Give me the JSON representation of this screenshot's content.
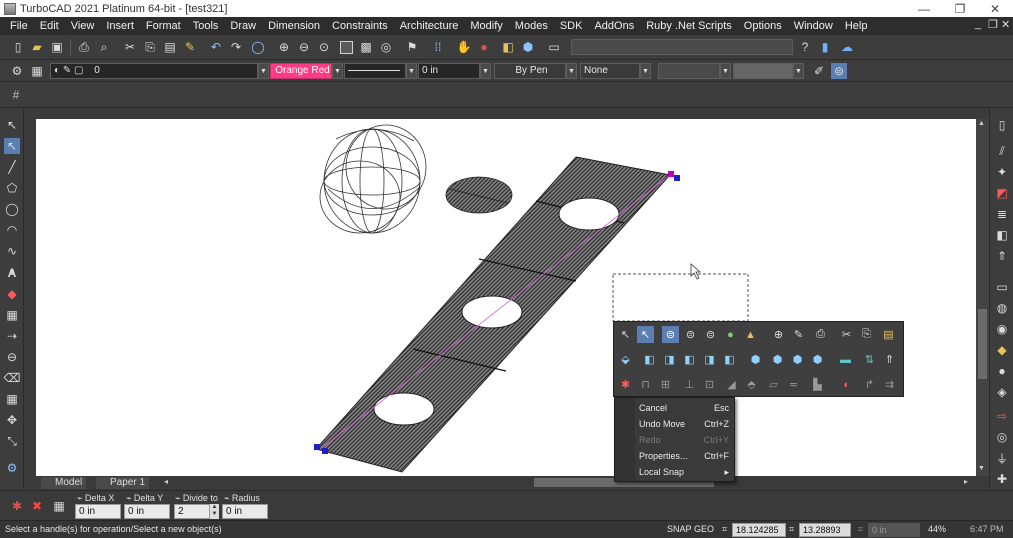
{
  "window": {
    "title": "TurboCAD 2021 Platinum 64-bit - [test321]",
    "controls": {
      "minimize": "—",
      "restore": "❐",
      "close": "✕"
    }
  },
  "menubar": {
    "items": [
      "File",
      "Edit",
      "View",
      "Insert",
      "Format",
      "Tools",
      "Draw",
      "Dimension",
      "Constraints",
      "Architecture",
      "Modify",
      "Modes",
      "SDK",
      "AddOns",
      "Ruby .Net Scripts",
      "Options",
      "Window",
      "Help"
    ]
  },
  "property_bar": {
    "layer": "0",
    "color": "Orange Red",
    "color_hex": "#ff3c82",
    "thickness": "0 in",
    "by_pen": "By Pen",
    "none": "None"
  },
  "tabs": {
    "model": "Model",
    "paper": "Paper 1"
  },
  "context_menu": {
    "items": [
      {
        "label": "Cancel",
        "shortcut": "Esc",
        "disabled": false
      },
      {
        "label": "Undo Move",
        "shortcut": "Ctrl+Z",
        "disabled": false
      },
      {
        "label": "Redo",
        "shortcut": "Ctrl+Y",
        "disabled": true
      },
      {
        "label": "Properties...",
        "shortcut": "Ctrl+F",
        "disabled": false
      },
      {
        "label": "Local Snap",
        "shortcut": "▸",
        "disabled": false
      }
    ]
  },
  "inspector_bar": {
    "delta_x_label": "Delta X",
    "delta_x_value": "0 in",
    "delta_y_label": "Delta Y",
    "delta_y_value": "0 in",
    "divide_label": "Divide to",
    "divide_value": "2",
    "radius_label": "Radius",
    "radius_value": "0 in"
  },
  "statusbar": {
    "message": "Select a handle(s) for operation/Select a new object(s)",
    "snap": "SNAP",
    "geo": "GEO",
    "x": "18.124285 in",
    "y": "13.28893 in",
    "z": "0 in",
    "zoom": "44%",
    "time": "6:47 PM"
  },
  "colors": {
    "accent_pink": "#ff3c82",
    "handle_magenta": "#c000c0",
    "handle_blue": "#2020c0"
  }
}
